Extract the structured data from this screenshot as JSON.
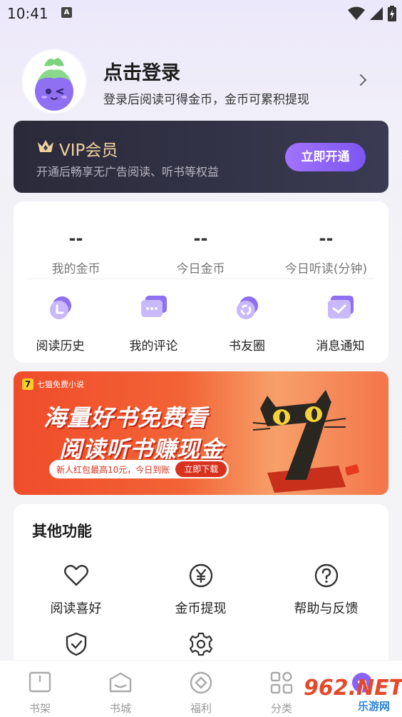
{
  "status_bar": {
    "time": "10:41",
    "notification_badge": "A"
  },
  "profile": {
    "title": "点击登录",
    "subtitle": "登录后阅读可得金币，金币可累积提现"
  },
  "vip": {
    "title": "VIP会员",
    "subtitle": "开通后畅享无广告阅读、听书等权益",
    "button": "立即开通"
  },
  "stats": [
    {
      "value": "--",
      "label": "我的金币"
    },
    {
      "value": "--",
      "label": "今日金币"
    },
    {
      "value": "--",
      "label": "今日听读(分钟)"
    }
  ],
  "quick_links": [
    {
      "label": "阅读历史",
      "icon": "reading-history-icon"
    },
    {
      "label": "我的评论",
      "icon": "comment-icon"
    },
    {
      "label": "书友圈",
      "icon": "book-friends-icon"
    },
    {
      "label": "消息通知",
      "icon": "message-icon"
    }
  ],
  "banner": {
    "brand": "七猫免费小说",
    "brand_logo": "7",
    "headline1": "海量好书免费看",
    "headline2": "阅读听书赚现金",
    "promo": "新人红包最高10元，今日到账",
    "promo_button": "立即下载"
  },
  "other": {
    "title": "其他功能",
    "items": [
      {
        "label": "阅读喜好",
        "icon": "heart-icon"
      },
      {
        "label": "金币提现",
        "icon": "yuan-coin-icon"
      },
      {
        "label": "帮助与反馈",
        "icon": "help-icon"
      },
      {
        "label": "",
        "icon": "shield-icon"
      },
      {
        "label": "",
        "icon": "settings-gear-icon"
      }
    ]
  },
  "bottom_nav": [
    {
      "label": "书架",
      "icon": "bookshelf-icon"
    },
    {
      "label": "书城",
      "icon": "bookstore-icon"
    },
    {
      "label": "福利",
      "icon": "welfare-icon"
    },
    {
      "label": "分类",
      "icon": "category-icon"
    },
    {
      "label": "",
      "icon": "profile-icon"
    }
  ],
  "watermark": {
    "text": "962.NET",
    "sub": "乐游网"
  },
  "colors": {
    "accent": "#8a63f5",
    "vip_gold": "#f1d29e",
    "banner_red": "#f04c2b"
  }
}
